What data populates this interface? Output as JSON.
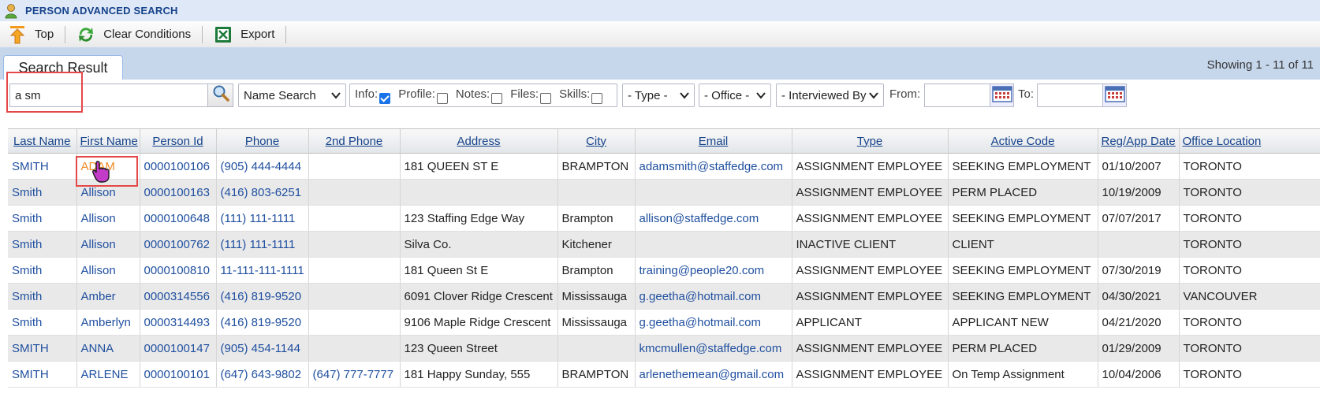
{
  "window": {
    "title": "PERSON ADVANCED SEARCH"
  },
  "toolbar": {
    "top_label": "Top",
    "clear_label": "Clear Conditions",
    "export_label": "Export"
  },
  "tabs": {
    "active": "Search Result"
  },
  "status": {
    "showing": "Showing 1 - 11 of 11"
  },
  "filters": {
    "search_value": "a sm",
    "search_mode": "Name Search",
    "info_label": "Info:",
    "profile_label": "Profile:",
    "notes_label": "Notes:",
    "files_label": "Files:",
    "skills_label": "Skills:",
    "type": "- Type -",
    "office": "- Office -",
    "interviewed": "- Interviewed By",
    "from_label": "From:",
    "to_label": "To:"
  },
  "columns": [
    "Last Name",
    "First Name",
    "Person Id",
    "Phone",
    "2nd Phone",
    "Address",
    "City",
    "Email",
    "Type",
    "Active Code",
    "Reg/App Date",
    "Office Location"
  ],
  "rows": [
    [
      "SMITH",
      "ADAM",
      "0000100106",
      "(905) 444-4444",
      "",
      "181 QUEEN ST E",
      "BRAMPTON",
      "adamsmith@staffedge.com",
      "ASSIGNMENT EMPLOYEE",
      "SEEKING EMPLOYMENT",
      "01/10/2007",
      "TORONTO"
    ],
    [
      "Smith",
      "Allison",
      "0000100163",
      "(416) 803-6251",
      "",
      "",
      "",
      "",
      "ASSIGNMENT EMPLOYEE",
      "PERM PLACED",
      "10/19/2009",
      "TORONTO"
    ],
    [
      "Smith",
      "Allison",
      "0000100648",
      "(111) 111-1111",
      "",
      "123 Staffing Edge Way",
      "Brampton",
      "allison@staffedge.com",
      "ASSIGNMENT EMPLOYEE",
      "SEEKING EMPLOYMENT",
      "07/07/2017",
      "TORONTO"
    ],
    [
      "Smith",
      "Allison",
      "0000100762",
      "(111) 111-1111",
      "",
      "Silva Co.",
      "Kitchener",
      "",
      "INACTIVE CLIENT",
      "CLIENT",
      "",
      "TORONTO"
    ],
    [
      "Smith",
      "Allison",
      "0000100810",
      "11-111-111-1111",
      "",
      "181 Queen St E",
      "Brampton",
      "training@people20.com",
      "ASSIGNMENT EMPLOYEE",
      "SEEKING EMPLOYMENT",
      "07/30/2019",
      "TORONTO"
    ],
    [
      "Smith",
      "Amber",
      "0000314556",
      "(416) 819-9520",
      "",
      "6091 Clover Ridge Crescent",
      "Mississauga",
      "g.geetha@hotmail.com",
      "ASSIGNMENT EMPLOYEE",
      "SEEKING EMPLOYMENT",
      "04/30/2021",
      "VANCOUVER"
    ],
    [
      "Smith",
      "Amberlyn",
      "0000314493",
      "(416) 819-9520",
      "",
      "9106 Maple Ridge Crescent",
      "Mississauga",
      "g.geetha@hotmail.com",
      "APPLICANT",
      "APPLICANT NEW",
      "04/21/2020",
      "TORONTO"
    ],
    [
      "SMITH",
      "ANNA",
      "0000100147",
      "(905) 454-1144",
      "",
      "123 Queen Street",
      "",
      "kmcmullen@staffedge.com",
      "ASSIGNMENT EMPLOYEE",
      "PERM PLACED",
      "01/29/2009",
      "TORONTO"
    ],
    [
      "SMITH",
      "ARLENE",
      "0000100101",
      "(647) 643-9802",
      "(647) 777-7777",
      "181 Happy Sunday, 555",
      "BRAMPTON",
      "arlenethemean@gmail.com",
      "ASSIGNMENT EMPLOYEE",
      "On Temp Assignment",
      "10/04/2006",
      "TORONTO"
    ]
  ],
  "colors": {
    "header_bg": "#dfe8f6",
    "link": "#1f4f9f",
    "highlight": "#e44848",
    "selected_link": "#f08a24"
  }
}
